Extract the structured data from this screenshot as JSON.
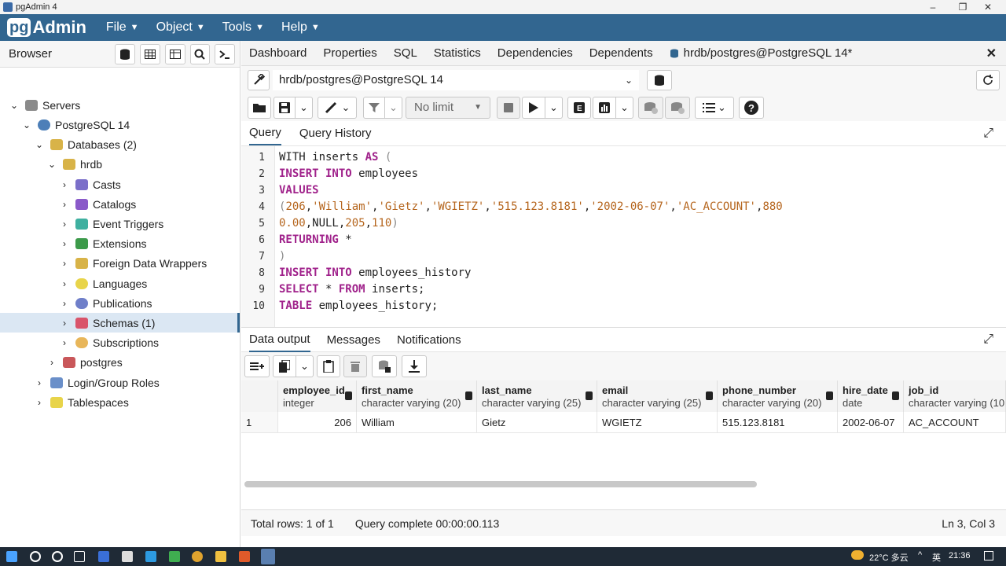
{
  "window": {
    "title": "pgAdmin 4",
    "min": "–",
    "max": "❐",
    "close": "✕"
  },
  "menubar": {
    "logo_pg": "pg",
    "logo_rest": "Admin",
    "items": [
      "File",
      "Object",
      "Tools",
      "Help"
    ]
  },
  "browser": {
    "title": "Browser",
    "tree": [
      {
        "label": "Servers"
      },
      {
        "label": "PostgreSQL 14"
      },
      {
        "label": "Databases (2)"
      },
      {
        "label": "hrdb"
      },
      {
        "label": "Casts"
      },
      {
        "label": "Catalogs"
      },
      {
        "label": "Event Triggers"
      },
      {
        "label": "Extensions"
      },
      {
        "label": "Foreign Data Wrappers"
      },
      {
        "label": "Languages"
      },
      {
        "label": "Publications"
      },
      {
        "label": "Schemas (1)"
      },
      {
        "label": "Subscriptions"
      },
      {
        "label": "postgres"
      },
      {
        "label": "Login/Group Roles"
      },
      {
        "label": "Tablespaces"
      }
    ]
  },
  "tabs": [
    "Dashboard",
    "Properties",
    "SQL",
    "Statistics",
    "Dependencies",
    "Dependents"
  ],
  "active_tab": "hrdb/postgres@PostgreSQL 14*",
  "connection": "hrdb/postgres@PostgreSQL 14",
  "limit": "No limit",
  "query_tabs": [
    "Query",
    "Query History"
  ],
  "code_lines": [
    "1",
    "2",
    "3",
    "4",
    "5",
    "6",
    "7",
    "8",
    "9",
    "10"
  ],
  "output_tabs": [
    "Data output",
    "Messages",
    "Notifications"
  ],
  "columns": [
    {
      "name": "employee_id",
      "type": "integer"
    },
    {
      "name": "first_name",
      "type": "character varying (20)"
    },
    {
      "name": "last_name",
      "type": "character varying (25)"
    },
    {
      "name": "email",
      "type": "character varying (25)"
    },
    {
      "name": "phone_number",
      "type": "character varying (20)"
    },
    {
      "name": "hire_date",
      "type": "date"
    },
    {
      "name": "job_id",
      "type": "character varying (10"
    }
  ],
  "rows": [
    {
      "num": "1",
      "cells": [
        "206",
        "William",
        "Gietz",
        "WGIETZ",
        "515.123.8181",
        "2002-06-07",
        "AC_ACCOUNT"
      ]
    }
  ],
  "status": {
    "total": "Total rows: 1 of 1",
    "query": "Query complete 00:00:00.113",
    "pos": "Ln 3, Col 3"
  },
  "taskbar": {
    "weather": "22°C 多云",
    "ime": "英",
    "time": "21:36"
  }
}
